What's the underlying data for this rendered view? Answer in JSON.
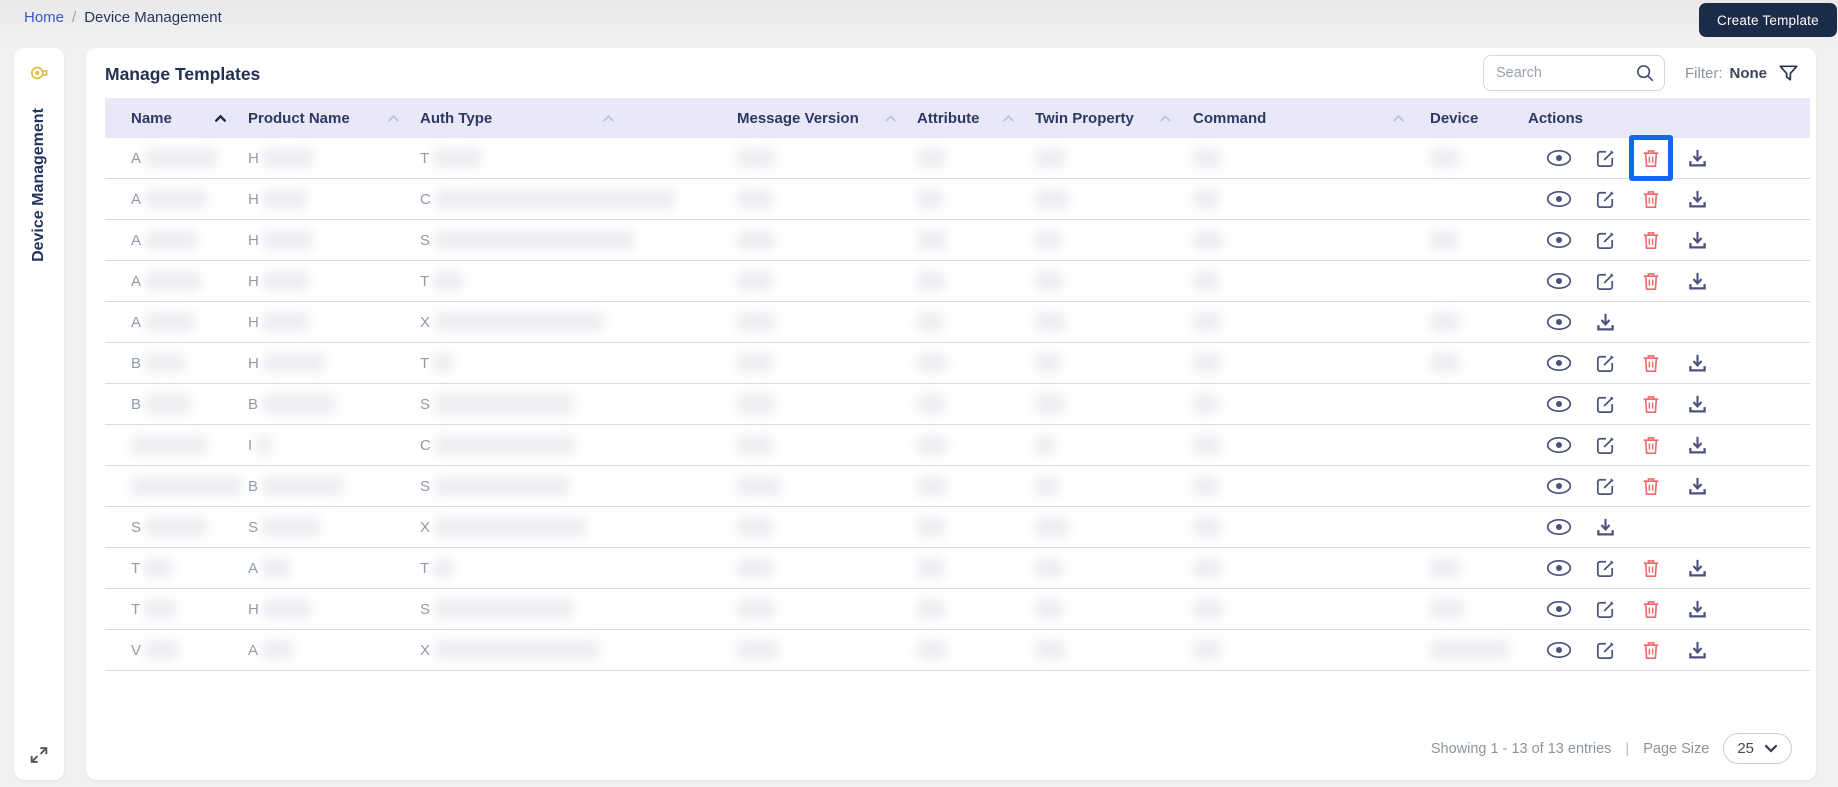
{
  "breadcrumb": {
    "home": "Home",
    "separator": "/",
    "current": "Device Management"
  },
  "create_button": {
    "label": "Create Template"
  },
  "sidebar": {
    "label": "Device Management",
    "icons": [
      "module-icon",
      "expand-icon"
    ]
  },
  "panel": {
    "title": "Manage Templates"
  },
  "search": {
    "placeholder": "Search"
  },
  "filter": {
    "label": "Filter:",
    "value": "None",
    "icon": "funnel-icon"
  },
  "table": {
    "columns": [
      {
        "label": "Name",
        "sort": "asc-active"
      },
      {
        "label": "Product Name",
        "sort": "sortable"
      },
      {
        "label": "Auth Type",
        "sort": "sortable"
      },
      {
        "label": "Message Version",
        "sort": "sortable"
      },
      {
        "label": "Attribute",
        "sort": "sortable"
      },
      {
        "label": "Twin Property",
        "sort": "sortable"
      },
      {
        "label": "Command",
        "sort": "sortable"
      },
      {
        "label": "Device",
        "sort": "none"
      },
      {
        "label": "Actions",
        "sort": "none"
      }
    ],
    "action_icons": [
      "view-eye",
      "edit-pencil",
      "delete-trash",
      "download-tray"
    ],
    "rows": [
      {
        "cells": [
          {
            "initial": "A",
            "blur": 72
          },
          {
            "initial": "H",
            "blur": 50
          },
          {
            "initial": "T",
            "blur": 48
          },
          {
            "initial": "",
            "blur": 38
          },
          {
            "initial": "",
            "blur": 28
          },
          {
            "initial": "",
            "blur": 30
          },
          {
            "initial": "",
            "blur": 28
          },
          {
            "initial": "",
            "blur": 30
          }
        ],
        "actions": "full",
        "highlighted_action": "delete"
      },
      {
        "cells": [
          {
            "initial": "A",
            "blur": 62
          },
          {
            "initial": "H",
            "blur": 44
          },
          {
            "initial": "C",
            "blur": 240
          },
          {
            "initial": "",
            "blur": 36
          },
          {
            "initial": "",
            "blur": 26
          },
          {
            "initial": "",
            "blur": 34
          },
          {
            "initial": "",
            "blur": 26
          },
          {
            "initial": "",
            "blur": 0
          }
        ],
        "actions": "full",
        "highlighted_action": ""
      },
      {
        "cells": [
          {
            "initial": "A",
            "blur": 52
          },
          {
            "initial": "H",
            "blur": 50
          },
          {
            "initial": "S",
            "blur": 200
          },
          {
            "initial": "",
            "blur": 38
          },
          {
            "initial": "",
            "blur": 30
          },
          {
            "initial": "",
            "blur": 26
          },
          {
            "initial": "",
            "blur": 30
          },
          {
            "initial": "",
            "blur": 28
          }
        ],
        "actions": "full",
        "highlighted_action": ""
      },
      {
        "cells": [
          {
            "initial": "A",
            "blur": 56
          },
          {
            "initial": "H",
            "blur": 46
          },
          {
            "initial": "T",
            "blur": 30
          },
          {
            "initial": "",
            "blur": 36
          },
          {
            "initial": "",
            "blur": 28
          },
          {
            "initial": "",
            "blur": 28
          },
          {
            "initial": "",
            "blur": 26
          },
          {
            "initial": "",
            "blur": 0
          }
        ],
        "actions": "full",
        "highlighted_action": ""
      },
      {
        "cells": [
          {
            "initial": "A",
            "blur": 50
          },
          {
            "initial": "H",
            "blur": 46
          },
          {
            "initial": "X",
            "blur": 170
          },
          {
            "initial": "",
            "blur": 38
          },
          {
            "initial": "",
            "blur": 26
          },
          {
            "initial": "",
            "blur": 30
          },
          {
            "initial": "",
            "blur": 28
          },
          {
            "initial": "",
            "blur": 30
          }
        ],
        "actions": "view-download",
        "highlighted_action": ""
      },
      {
        "cells": [
          {
            "initial": "B",
            "blur": 40
          },
          {
            "initial": "H",
            "blur": 62
          },
          {
            "initial": "T",
            "blur": 20
          },
          {
            "initial": "",
            "blur": 36
          },
          {
            "initial": "",
            "blur": 30
          },
          {
            "initial": "",
            "blur": 26
          },
          {
            "initial": "",
            "blur": 28
          },
          {
            "initial": "",
            "blur": 30
          }
        ],
        "actions": "full",
        "highlighted_action": ""
      },
      {
        "cells": [
          {
            "initial": "B",
            "blur": 46
          },
          {
            "initial": "B",
            "blur": 74
          },
          {
            "initial": "S",
            "blur": 140
          },
          {
            "initial": "",
            "blur": 38
          },
          {
            "initial": "",
            "blur": 28
          },
          {
            "initial": "",
            "blur": 30
          },
          {
            "initial": "",
            "blur": 26
          },
          {
            "initial": "",
            "blur": 0
          }
        ],
        "actions": "full",
        "highlighted_action": ""
      },
      {
        "cells": [
          {
            "initial": "",
            "blur": 76
          },
          {
            "initial": "I",
            "blur": 16
          },
          {
            "initial": "C",
            "blur": 140
          },
          {
            "initial": "",
            "blur": 36
          },
          {
            "initial": "",
            "blur": 30
          },
          {
            "initial": "",
            "blur": 20
          },
          {
            "initial": "",
            "blur": 28
          },
          {
            "initial": "",
            "blur": 0
          }
        ],
        "actions": "full",
        "highlighted_action": ""
      },
      {
        "cells": [
          {
            "initial": "",
            "blur": 110
          },
          {
            "initial": "B",
            "blur": 82
          },
          {
            "initial": "S",
            "blur": 135
          },
          {
            "initial": "",
            "blur": 44
          },
          {
            "initial": "",
            "blur": 30
          },
          {
            "initial": "",
            "blur": 24
          },
          {
            "initial": "",
            "blur": 26
          },
          {
            "initial": "",
            "blur": 0
          }
        ],
        "actions": "full",
        "highlighted_action": ""
      },
      {
        "cells": [
          {
            "initial": "S",
            "blur": 62
          },
          {
            "initial": "S",
            "blur": 58
          },
          {
            "initial": "X",
            "blur": 152
          },
          {
            "initial": "",
            "blur": 36
          },
          {
            "initial": "",
            "blur": 28
          },
          {
            "initial": "",
            "blur": 34
          },
          {
            "initial": "",
            "blur": 28
          },
          {
            "initial": "",
            "blur": 0
          }
        ],
        "actions": "view-download",
        "highlighted_action": ""
      },
      {
        "cells": [
          {
            "initial": "T",
            "blur": 28
          },
          {
            "initial": "A",
            "blur": 28
          },
          {
            "initial": "T",
            "blur": 20
          },
          {
            "initial": "",
            "blur": 36
          },
          {
            "initial": "",
            "blur": 28
          },
          {
            "initial": "",
            "blur": 28
          },
          {
            "initial": "",
            "blur": 28
          },
          {
            "initial": "",
            "blur": 30
          }
        ],
        "actions": "full",
        "highlighted_action": ""
      },
      {
        "cells": [
          {
            "initial": "T",
            "blur": 32
          },
          {
            "initial": "H",
            "blur": 48
          },
          {
            "initial": "S",
            "blur": 140
          },
          {
            "initial": "",
            "blur": 38
          },
          {
            "initial": "",
            "blur": 28
          },
          {
            "initial": "",
            "blur": 28
          },
          {
            "initial": "",
            "blur": 30
          },
          {
            "initial": "",
            "blur": 34
          }
        ],
        "actions": "full",
        "highlighted_action": ""
      },
      {
        "cells": [
          {
            "initial": "V",
            "blur": 34
          },
          {
            "initial": "A",
            "blur": 32
          },
          {
            "initial": "X",
            "blur": 165
          },
          {
            "initial": "",
            "blur": 42
          },
          {
            "initial": "",
            "blur": 30
          },
          {
            "initial": "",
            "blur": 30
          },
          {
            "initial": "",
            "blur": 28
          },
          {
            "initial": "",
            "blur": 80
          }
        ],
        "actions": "full",
        "highlighted_action": ""
      }
    ]
  },
  "footer": {
    "showing": "Showing 1 - 13 of 13 entries",
    "divider": "|",
    "page_size_label": "Page Size",
    "page_size_value": "25"
  },
  "colors": {
    "highlight_blue": "#1268e9",
    "danger_red": "#f0696d",
    "icon_navy": "#4a527d",
    "button_navy": "#1d2b4a",
    "header_lavender": "#e9e8f8",
    "gold": "#e3bd3e",
    "link_blue": "#3a57c9"
  }
}
